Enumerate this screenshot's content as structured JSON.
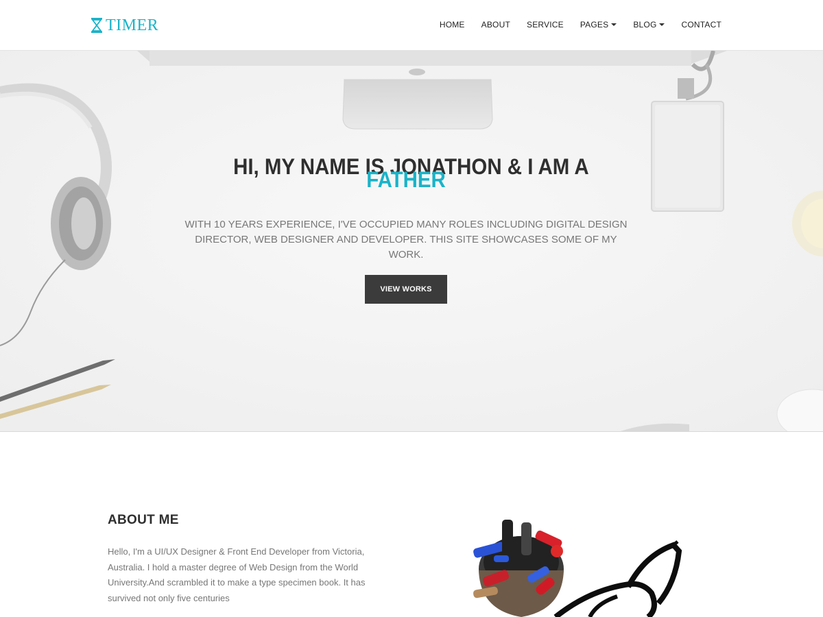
{
  "brand": {
    "name": "TIMER",
    "color": "#1ab3c8",
    "icon": "hourglass-icon"
  },
  "nav": {
    "items": [
      {
        "label": "HOME",
        "dropdown": false
      },
      {
        "label": "ABOUT",
        "dropdown": false
      },
      {
        "label": "SERVICE",
        "dropdown": false
      },
      {
        "label": "PAGES",
        "dropdown": true
      },
      {
        "label": "BLOG",
        "dropdown": true
      },
      {
        "label": "CONTACT",
        "dropdown": false
      }
    ]
  },
  "hero": {
    "title": "HI, MY NAME IS JONATHON & I AM A",
    "role": "FATHER",
    "description": "WITH 10 YEARS EXPERIENCE, I'VE OCCUPIED MANY ROLES INCLUDING DIGITAL DESIGN DIRECTOR, WEB DESIGNER AND DEVELOPER. THIS SITE SHOWCASES SOME OF MY WORK.",
    "button_label": "VIEW WORKS",
    "accent_color": "#1ab3c8",
    "button_color": "#3b3b3b"
  },
  "about": {
    "title": "ABOUT ME",
    "text": "Hello, I'm a UI/UX Designer & Front End Developer from Victoria, Australia. I hold a master degree of Web Design from the World University.And scrambled it to make a type specimen book. It has survived not only five centuries"
  }
}
